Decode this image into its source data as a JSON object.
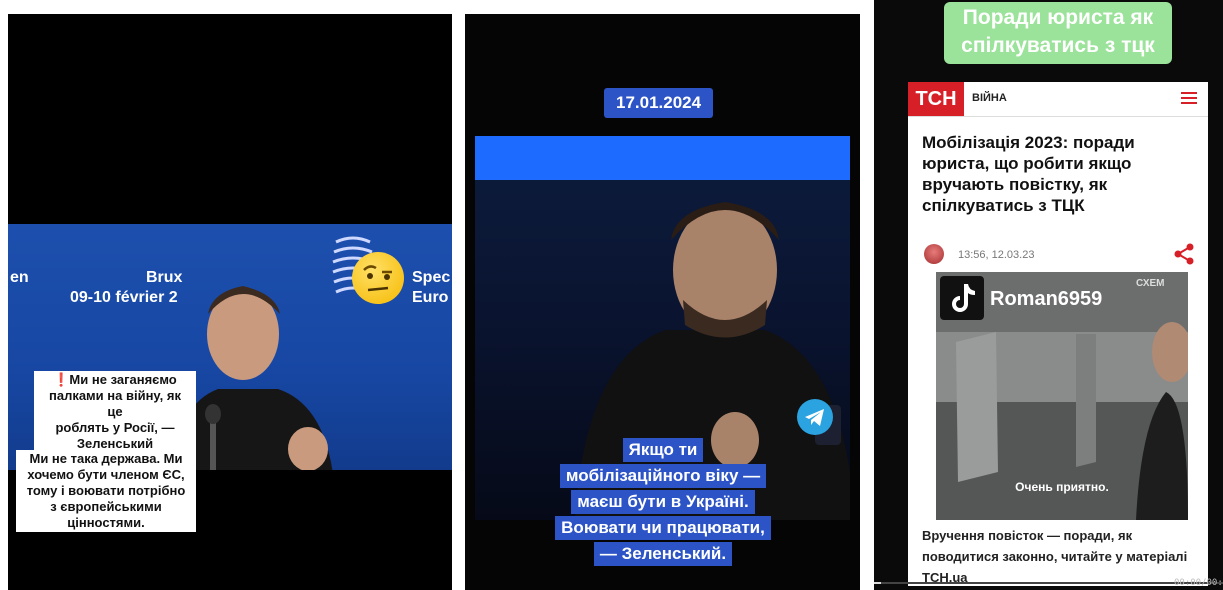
{
  "panel1": {
    "background_text": {
      "left": "en",
      "city": "Brux",
      "dates": "09-10 février 2",
      "right_top": "Spec",
      "right_bottom": "Euro"
    },
    "caption_top_lines": [
      "❗Ми не заганяємо",
      "палками на війну, як це",
      "роблять у Росії, —",
      "Зеленський"
    ],
    "caption_bottom_lines": [
      "Ми не така держава. Ми",
      "хочемо бути членом ЄС,",
      "тому і воювати потрібно",
      "з європейськими",
      "цінностями."
    ],
    "emoji_icon": "raised-eyebrow-face-icon"
  },
  "panel2": {
    "date": "17.01.2024",
    "caption_lines": [
      "Якщо ти",
      "мобілізаційного віку —",
      "маєш бути в Україні.",
      "Воювати чи працювати,",
      "— Зеленський."
    ],
    "icon": "telegram-icon"
  },
  "panel3": {
    "green_caption_lines": [
      "Поради юриста як",
      "спілкуватись з тцк"
    ],
    "site": {
      "logo": "ТСН",
      "category": "ВІЙНА"
    },
    "article": {
      "title": "Мобілізація 2023: поради юриста, що робити якщо вручають повістку, як спілкуватись з ТЦК",
      "time": "13:56, 12.03.23",
      "lead": "Вручення повісток — поради, як поводитися законно, читайте у матеріалі TCH.ua"
    },
    "video": {
      "username": "Roman6959",
      "brand": "СХЕМ",
      "subtitle": "Очень приятно."
    },
    "player": {
      "timecode": "00:00/00:28",
      "progress": 0.02
    }
  },
  "colors": {
    "blue_caption": "#2c54c6",
    "green_caption": "#9be29a",
    "tsn_red": "#d61f26"
  }
}
